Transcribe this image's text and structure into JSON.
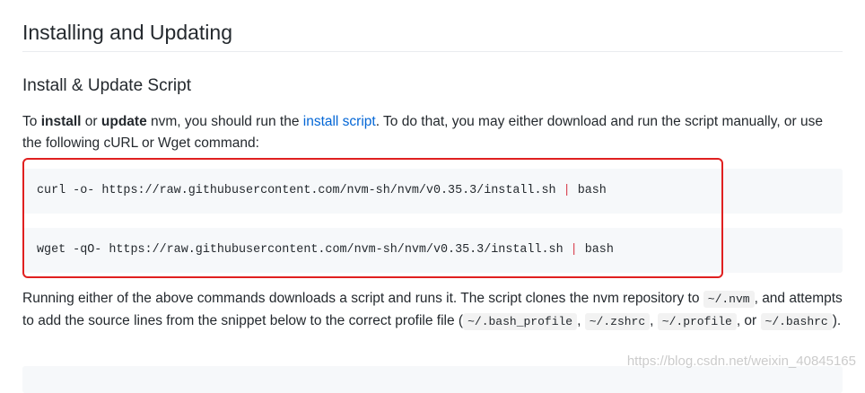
{
  "heading": "Installing and Updating",
  "subheading": "Install & Update Script",
  "intro": {
    "p1": "To ",
    "install": "install",
    "p2": " or ",
    "update": "update",
    "p3": " nvm, you should run the ",
    "link": "install script",
    "p4": ". To do that, you may either download and run the script manually, or use the following cURL or Wget command:"
  },
  "commands": [
    {
      "cmd": "curl -o- https://raw.githubusercontent.com/nvm-sh/nvm/v0.35.3/install.sh ",
      "pipe": "|",
      "tail": " bash"
    },
    {
      "cmd": "wget -qO- https://raw.githubusercontent.com/nvm-sh/nvm/v0.35.3/install.sh ",
      "pipe": "|",
      "tail": " bash"
    }
  ],
  "after": {
    "t1": "Running either of the above commands downloads a script and runs it. The script clones the nvm repository to ",
    "c1": "~/.nvm",
    "t2": ", and attempts to add the source lines from the snippet below to the correct profile file (",
    "c2": "~/.bash_profile",
    "t3": ", ",
    "c3": "~/.zshrc",
    "t4": ", ",
    "c4": "~/.profile",
    "t5": ", or ",
    "c5": "~/.bashrc",
    "t6": ")."
  },
  "watermark": "https://blog.csdn.net/weixin_40845165",
  "colors": {
    "link": "#0366d6",
    "pipe": "#d73a49",
    "highlight": "#e02020"
  }
}
